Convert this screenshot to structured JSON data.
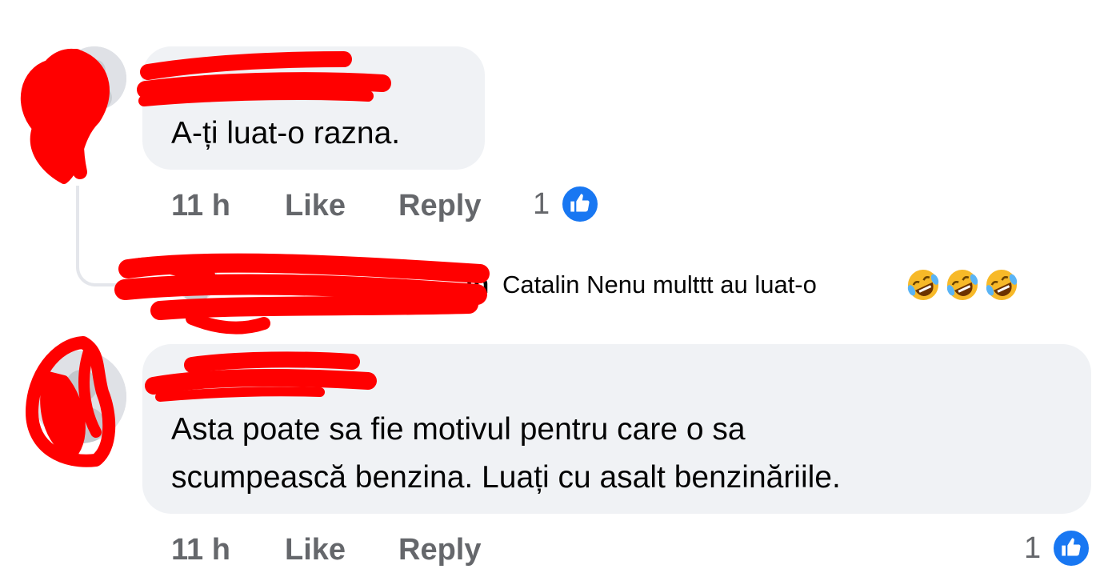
{
  "comments": [
    {
      "text": "A-ți luat-o razna.",
      "time": "11 h",
      "like_label": "Like",
      "reply_label": "Reply",
      "like_count": "1"
    },
    {
      "text_line1": "Asta poate sa fie motivul pentru care o sa",
      "text_line2": "scumpească benzina. Luați cu asalt benzinăriile.",
      "time": "11 h",
      "like_label": "Like",
      "reply_label": "Reply",
      "like_count": "1"
    }
  ],
  "reply_preview": {
    "author_suffix": "in",
    "text": "Catalin Nenu multtt au luat-o",
    "emoji": [
      "rolling-on-floor-laughing",
      "rolling-on-floor-laughing",
      "rolling-on-floor-laughing"
    ]
  },
  "colors": {
    "bubble": "#f0f2f5",
    "meta_text": "#65676b",
    "like_blue": "#1877f2",
    "redaction": "#ff0000"
  }
}
